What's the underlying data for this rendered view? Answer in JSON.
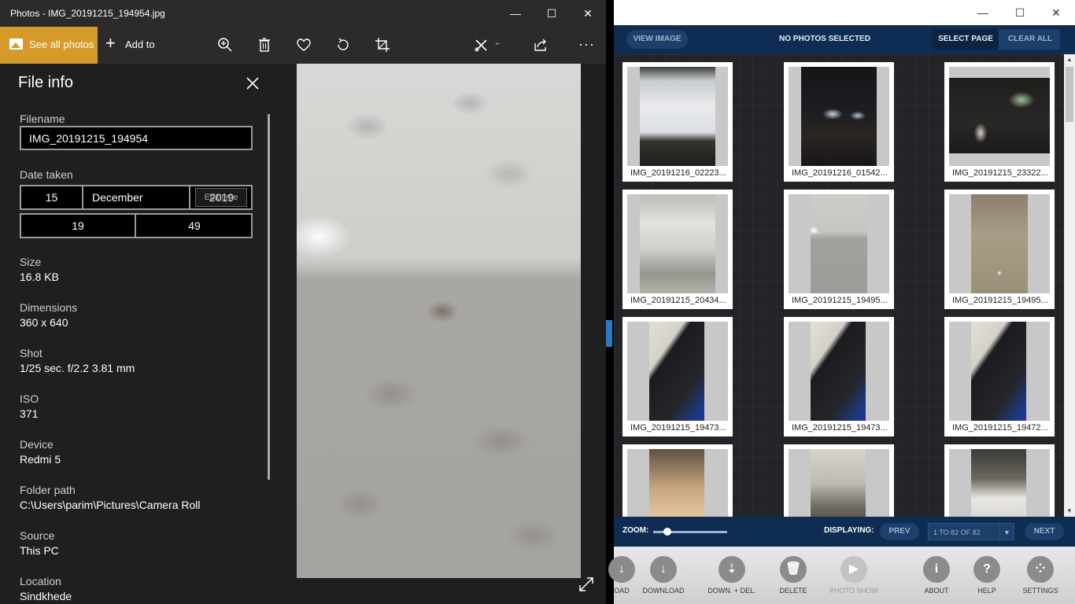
{
  "photos_window": {
    "title": "Photos - IMG_20191215_194954.jpg",
    "toolbar": {
      "see_all": "See all photos",
      "add_to": "Add to",
      "icons": [
        "zoom-icon",
        "delete-icon",
        "favorite-icon",
        "rotate-icon",
        "crop-icon",
        "edit-icon",
        "share-icon",
        "more-icon"
      ],
      "more_glyph": "···"
    },
    "file_info": {
      "title": "File info",
      "filename_label": "Filename",
      "filename_value": "IMG_20191215_194954",
      "date_label": "Date taken",
      "day": "15",
      "month": "December",
      "year": "2019",
      "year_overlay": "Edit time",
      "hour": "19",
      "minute": "49",
      "size_label": "Size",
      "size_value": "16.8 KB",
      "dimensions_label": "Dimensions",
      "dimensions_value": "360 x 640",
      "shot_label": "Shot",
      "shot_value": "1/25 sec. f/2.2 3.81 mm",
      "iso_label": "ISO",
      "iso_value": "371",
      "device_label": "Device",
      "device_value": "Redmi 5",
      "folder_label": "Folder path",
      "folder_value": "C:\\Users\\parim\\Pictures\\Camera Roll",
      "source_label": "Source",
      "source_value": "This PC",
      "location_label": "Location",
      "location_value": "Sindkhede"
    }
  },
  "app_window": {
    "top": {
      "view_image": "VIEW IMAGE",
      "no_selected": "NO PHOTOS SELECTED",
      "select_page": "SELECT PAGE",
      "clear_all": "CLEAR ALL"
    },
    "thumbnails": [
      {
        "caption": "IMG_20191216_02223..."
      },
      {
        "caption": "IMG_20191216_01542..."
      },
      {
        "caption": "IMG_20191215_23322..."
      },
      {
        "caption": "IMG_20191215_20434..."
      },
      {
        "caption": "IMG_20191215_19495..."
      },
      {
        "caption": "IMG_20191215_19495..."
      },
      {
        "caption": "IMG_20191215_19473..."
      },
      {
        "caption": "IMG_20191215_19473..."
      },
      {
        "caption": "IMG_20191215_19472..."
      },
      {
        "caption": ""
      },
      {
        "caption": ""
      },
      {
        "caption": ""
      }
    ],
    "bottom": {
      "zoom_label": "ZOOM:",
      "zoom_level": 0.15,
      "displaying_label": "DISPLAYING:",
      "prev": "PREV",
      "range": "1 TO 82 OF 82",
      "next": "NEXT"
    },
    "actions": [
      {
        "label": "OAD",
        "icon": "download-partial-icon"
      },
      {
        "label": "DOWNLOAD",
        "icon": "download-icon"
      },
      {
        "label": "DOWN. + DEL.",
        "icon": "download-delete-icon"
      },
      {
        "label": "DELETE",
        "icon": "trash-icon"
      },
      {
        "label": "PHOTO SHOW",
        "icon": "play-icon"
      },
      {
        "label": "ABOUT",
        "icon": "info-icon"
      },
      {
        "label": "HELP",
        "icon": "help-icon"
      },
      {
        "label": "SETTINGS",
        "icon": "settings-icon"
      }
    ]
  },
  "colors": {
    "accent_orange": "#d59a2a",
    "app_navy": "#0f2d52",
    "scroll_blue": "#2b78c7"
  }
}
